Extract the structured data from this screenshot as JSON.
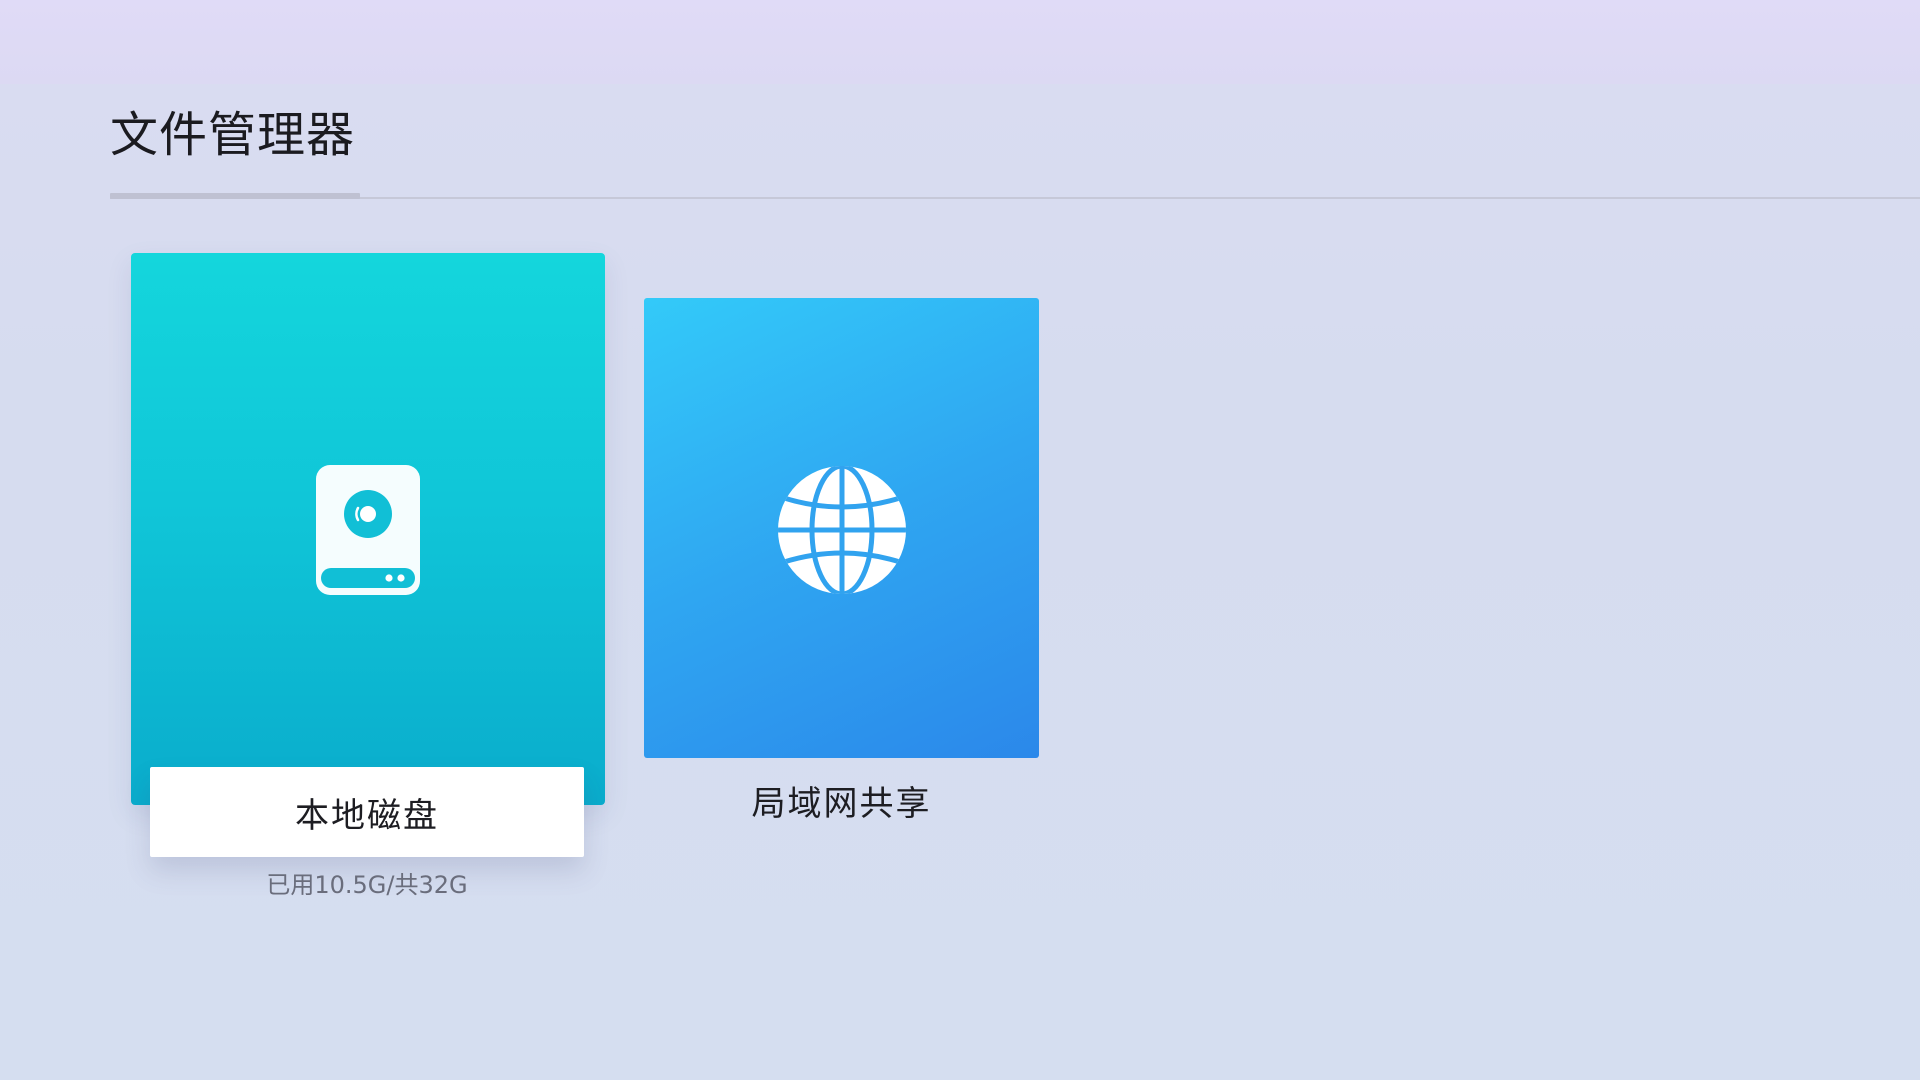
{
  "header": {
    "title": "文件管理器"
  },
  "sources": [
    {
      "id": "local",
      "label": "本地磁盘",
      "usage": "已用10.5G/共32G",
      "icon": "hard-disk-icon",
      "color": "#12cfdb",
      "focused": true
    },
    {
      "id": "lan",
      "label": "局域网共享",
      "icon": "globe-icon",
      "color": "#2fa6f1",
      "focused": false
    }
  ]
}
